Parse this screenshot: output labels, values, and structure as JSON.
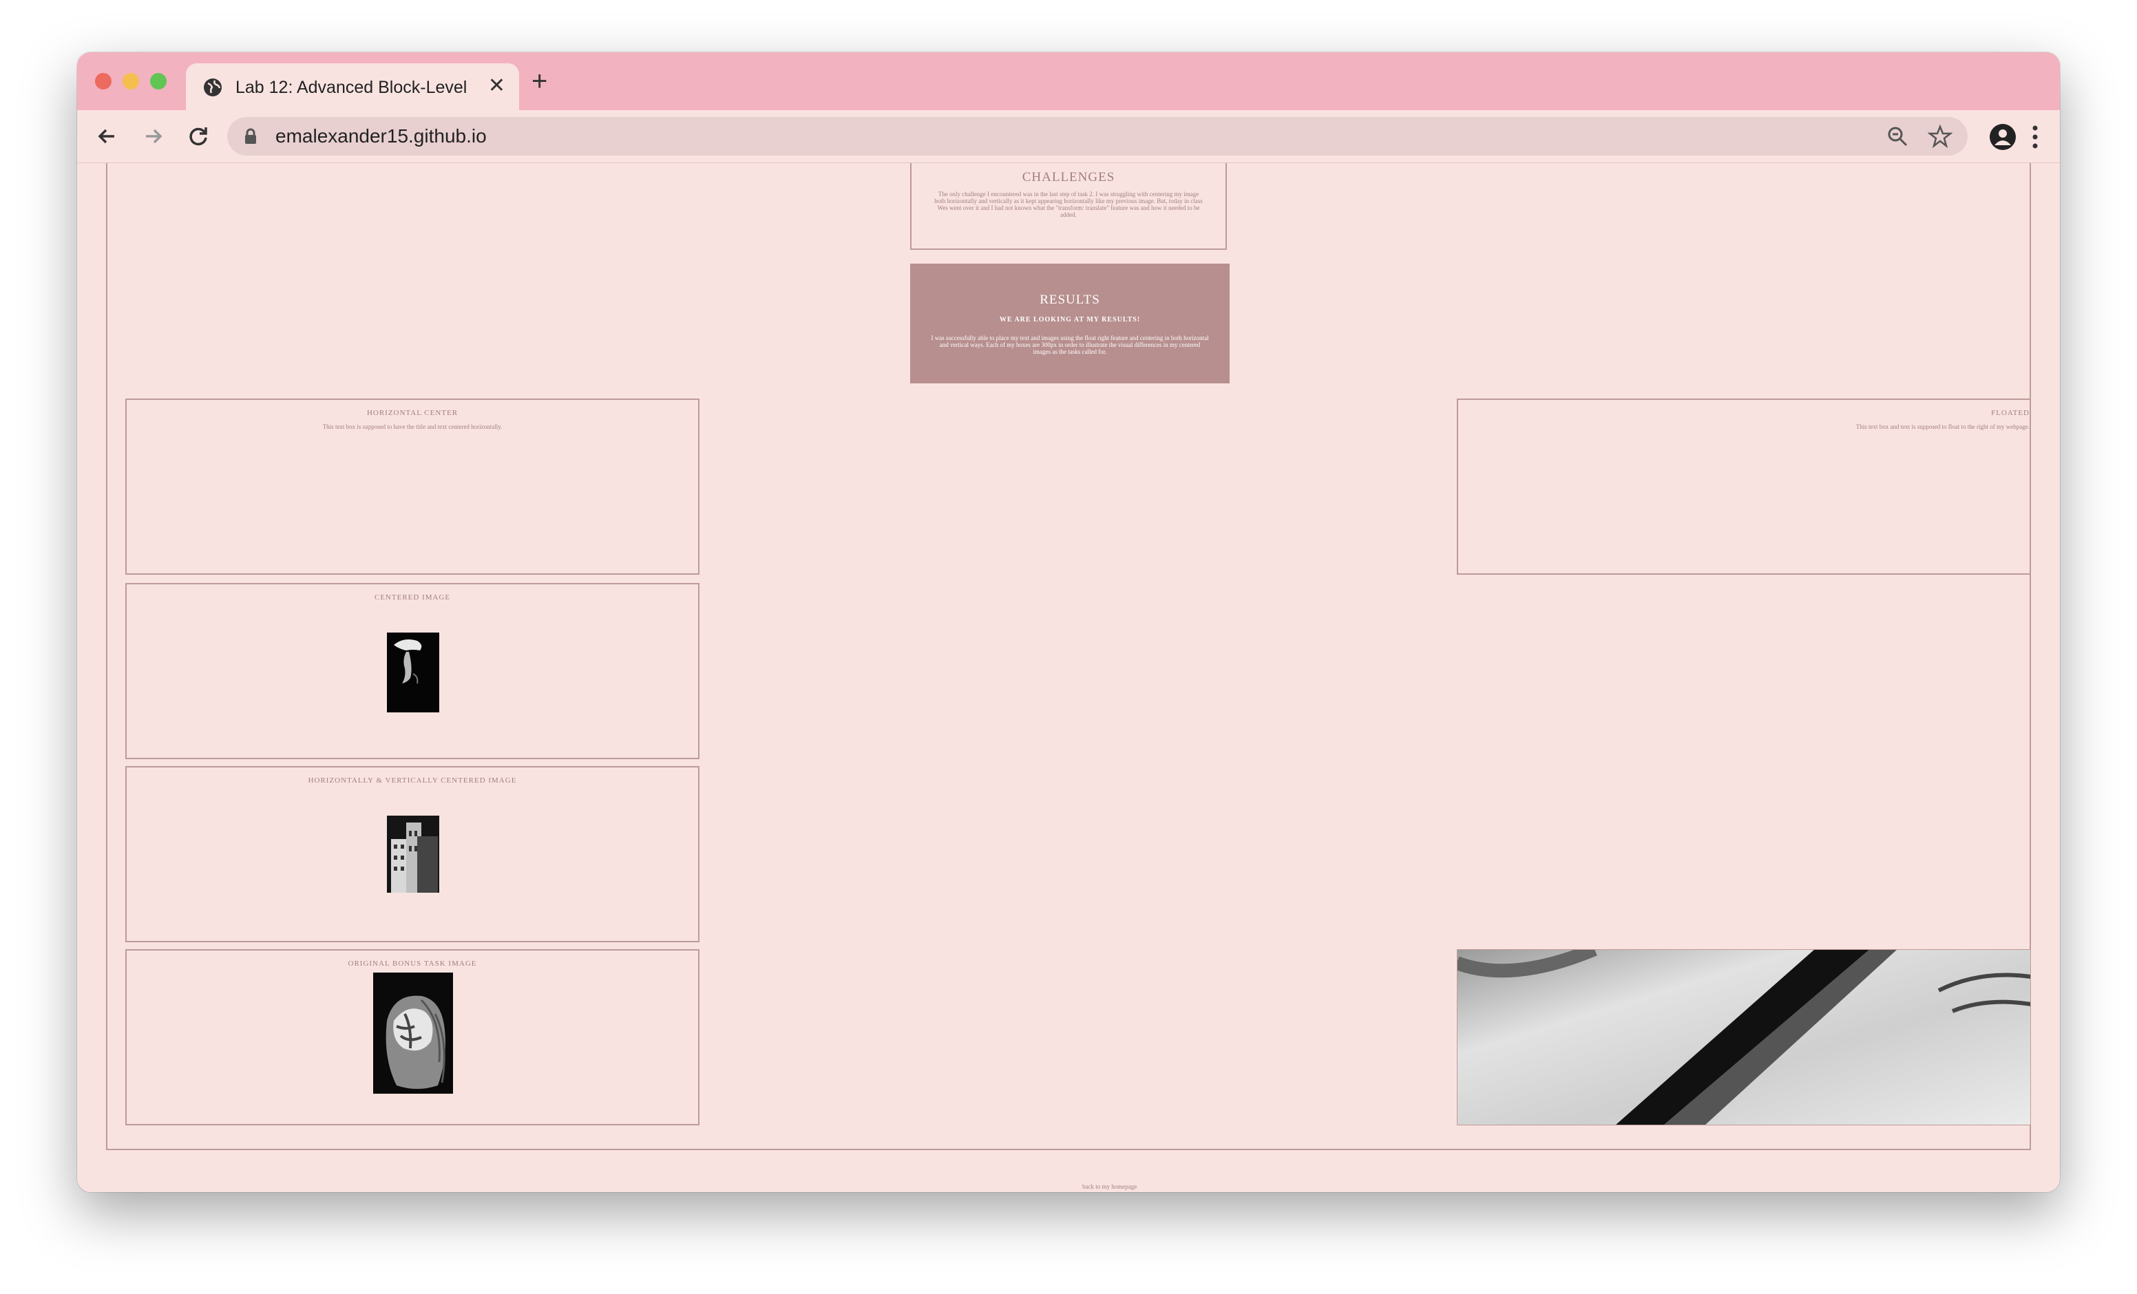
{
  "browser": {
    "tab_title": "Lab 12: Advanced Block-Level",
    "new_tab_label": "+",
    "close_label": "✕",
    "url": "emalexander15.github.io"
  },
  "page": {
    "challenges": {
      "title": "CHALLENGES",
      "text": "The only challenge I encountered was in the last step of task 2. I was struggling with centering my image both horizontally and vertically as it kept appearing horizontally like my previous image. But, today in class Wes went over it and I had not known what the \"transform: translate\" feature was and how it needed to be added."
    },
    "results": {
      "title": "RESULTS",
      "subtitle": "WE ARE LOOKING AT MY RESULTS!",
      "text": "I was successfully able to place my text and images using the float right feature and centering in both horizontal and vertical ways. Each of my boxes are 300px in order to illustrate the visual differences in my centered images as the tasks called for."
    },
    "horizontal_center": {
      "title": "HORIZONTAL CENTER",
      "text": "This text box is supposed to have the title and text centered horizontally."
    },
    "floated": {
      "title": "FLOATED",
      "text": "This text box and text is supposed to float to the right of my webpage."
    },
    "centered_image": {
      "title": "CENTERED IMAGE"
    },
    "hv_centered_image": {
      "title": "HORIZONTALLY & VERTICALLY CENTERED IMAGE"
    },
    "bonus_image": {
      "title": "ORIGINAL BONUS TASK IMAGE"
    },
    "back_link": "back to my homepage"
  },
  "colors": {
    "tab_bar": "#f3b2bf",
    "page_bg": "#f9e3e1",
    "border": "#bd9b99",
    "results_bg": "#b78f8e",
    "text": "#a07f7d"
  }
}
